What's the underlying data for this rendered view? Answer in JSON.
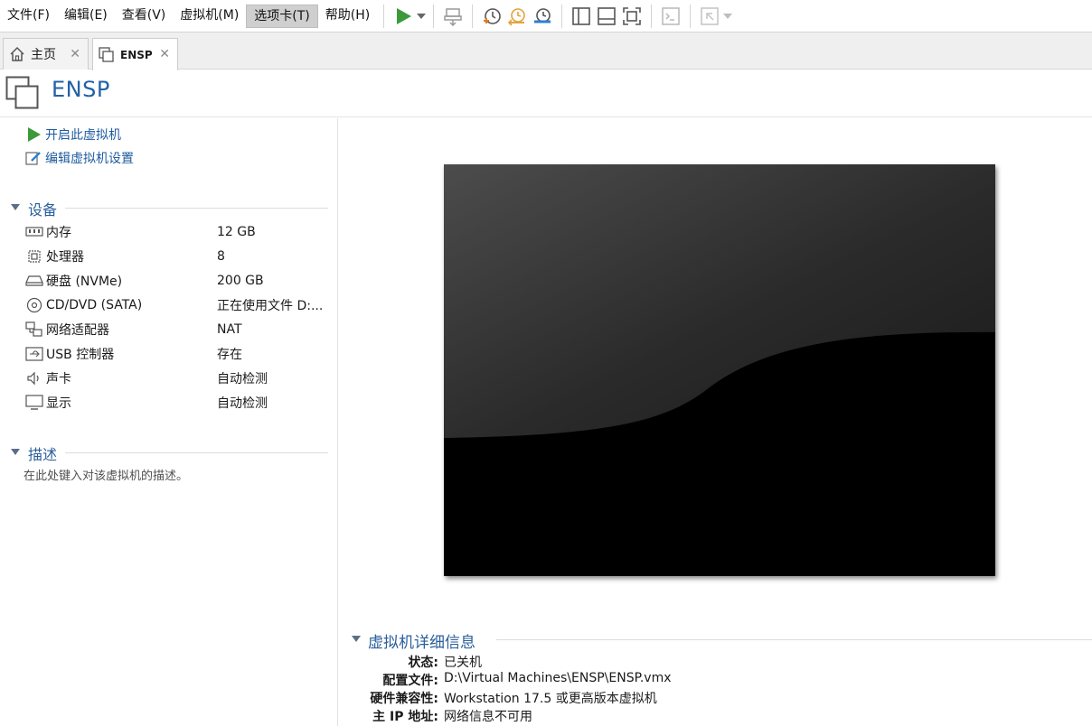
{
  "menu": {
    "file": "文件(F)",
    "edit": "编辑(E)",
    "view": "查看(V)",
    "vm": "虚拟机(M)",
    "tabs": "选项卡(T)",
    "help": "帮助(H)"
  },
  "toolbar": {
    "icons": [
      "play-icon",
      "send-ctrl-alt-del-icon",
      "snapshot-icon",
      "revert-snapshot-icon",
      "snapshot-manager-icon",
      "library-view-icon",
      "thumbnail-bar-icon",
      "full-screen-icon",
      "console-view-icon",
      "fit-window-icon"
    ]
  },
  "tabs": [
    {
      "label": "主页"
    },
    {
      "label": "ENSP"
    }
  ],
  "vm": {
    "title": "ENSP",
    "actions": {
      "power_on": "开启此虚拟机",
      "edit_settings": "编辑虚拟机设置"
    }
  },
  "devices": {
    "title": "设备",
    "items": [
      {
        "name": "内存",
        "value": "12 GB",
        "icon": "memory-icon"
      },
      {
        "name": "处理器",
        "value": "8",
        "icon": "processor-icon"
      },
      {
        "name": "硬盘 (NVMe)",
        "value": "200 GB",
        "icon": "hard-disk-icon"
      },
      {
        "name": "CD/DVD (SATA)",
        "value": "正在使用文件 D:...",
        "icon": "cd-dvd-icon"
      },
      {
        "name": "网络适配器",
        "value": "NAT",
        "icon": "network-adapter-icon"
      },
      {
        "name": "USB 控制器",
        "value": "存在",
        "icon": "usb-icon"
      },
      {
        "name": "声卡",
        "value": "自动检测",
        "icon": "sound-card-icon"
      },
      {
        "name": "显示",
        "value": "自动检测",
        "icon": "display-icon"
      }
    ]
  },
  "description": {
    "title": "描述",
    "placeholder": "在此处键入对该虚拟机的描述。"
  },
  "details": {
    "title": "虚拟机详细信息",
    "rows": [
      {
        "key": "状态:",
        "value": "已关机"
      },
      {
        "key": "配置文件:",
        "value": "D:\\Virtual Machines\\ENSP\\ENSP.vmx"
      },
      {
        "key": "硬件兼容性:",
        "value": "Workstation 17.5 或更高版本虚拟机"
      },
      {
        "key": "主 IP 地址:",
        "value": "网络信息不可用"
      }
    ]
  },
  "colors": {
    "accent": "#2161a8",
    "play_green": "#3c9a3c"
  }
}
